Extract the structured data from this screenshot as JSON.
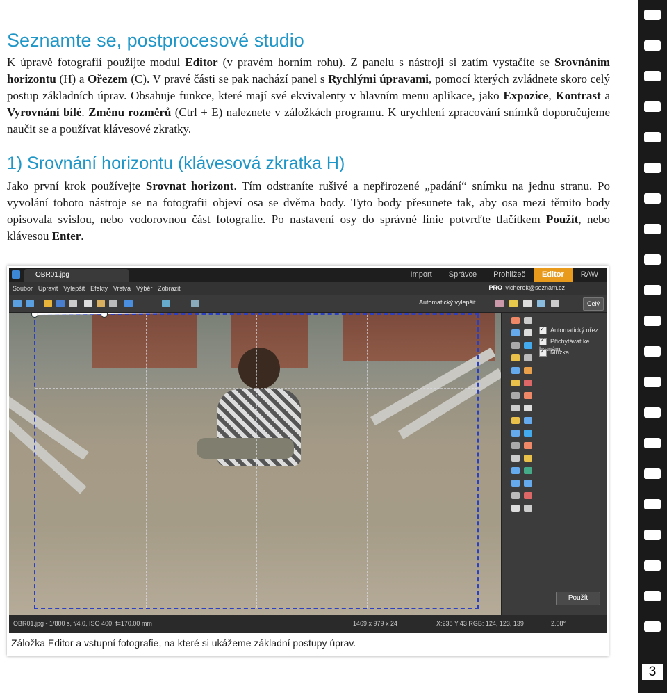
{
  "section1": {
    "title": "Seznamte se, postprocesové studio",
    "p1": "K úpravě fotografií použijte modul ",
    "p1_b1": "Editor",
    "p1_t2": " (v pravém horním rohu). Z panelu s nástroji si zatím vystačíte se ",
    "p1_b2": "Srovnáním horizontu",
    "p1_t3": " (H) a ",
    "p1_b3": "Ořezem",
    "p1_t4": " (C). V pravé části se pak nachází panel s ",
    "p1_b4": "Rychlými úpravami",
    "p1_t5": ", pomocí kterých zvládnete skoro celý postup základních úprav. Obsahuje funkce, které mají své ekvivalenty v hlavním menu aplikace, jako ",
    "p1_b5": "Expozice",
    "p1_t6": ", ",
    "p1_b6": "Kontrast",
    "p1_t7": " a ",
    "p1_b7": "Vyrovnání bílé",
    "p1_t8": ". ",
    "p1_b8": "Změnu rozměrů",
    "p1_t9": " (Ctrl + E) naleznete v záložkách programu. K urychlení zpracování snímků doporučujeme naučit se a používat klávesové zkratky."
  },
  "section2": {
    "title": "1) Srovnání horizontu (klávesová zkratka H)",
    "t1": "Jako první krok používejte ",
    "b1": "Srovnat horizont",
    "t2": ". Tím odstraníte rušivé a nepřirozené „padání“ snímku na jednu stranu. Po vyvolání tohoto nástroje se na fotografii objeví osa se dvěma body. Tyto body přesunete tak, aby osa mezi těmito body opisovala svislou, nebo vodorovnou část fotografie. Po nastavení osy do správné linie potvrďte tlačítkem ",
    "b2": "Použít",
    "t3": ", nebo klávesou ",
    "b3": "Enter",
    "t4": "."
  },
  "app": {
    "file_tab": "OBR01.jpg",
    "modules": [
      "Import",
      "Správce",
      "Prohlížeč",
      "Editor",
      "RAW"
    ],
    "menu": [
      "Soubor",
      "Upravit",
      "Vylepšit",
      "Efekty",
      "Vrstva",
      "Výběr",
      "Zobrazit"
    ],
    "pro": "PRO",
    "account": "vicherek@seznam.cz",
    "autofix": "Automatický vylepšit",
    "zoom": "Celý",
    "options": [
      "Automatický ořez",
      "Přichytávat ke hranám",
      "Mřížka"
    ],
    "apply": "Použít",
    "status_file": "OBR01.jpg - 1/800 s, f/4.0, ISO 400, f=170.00 mm",
    "status_dims": "1469 x 979 x 24",
    "status_pos": "X:238 Y:43  RGB: 124, 123, 139",
    "status_angle": "2.08°"
  },
  "caption": "Záložka Editor a vstupní fotografie, na které si ukážeme základní postupy úprav.",
  "page_number": "3"
}
